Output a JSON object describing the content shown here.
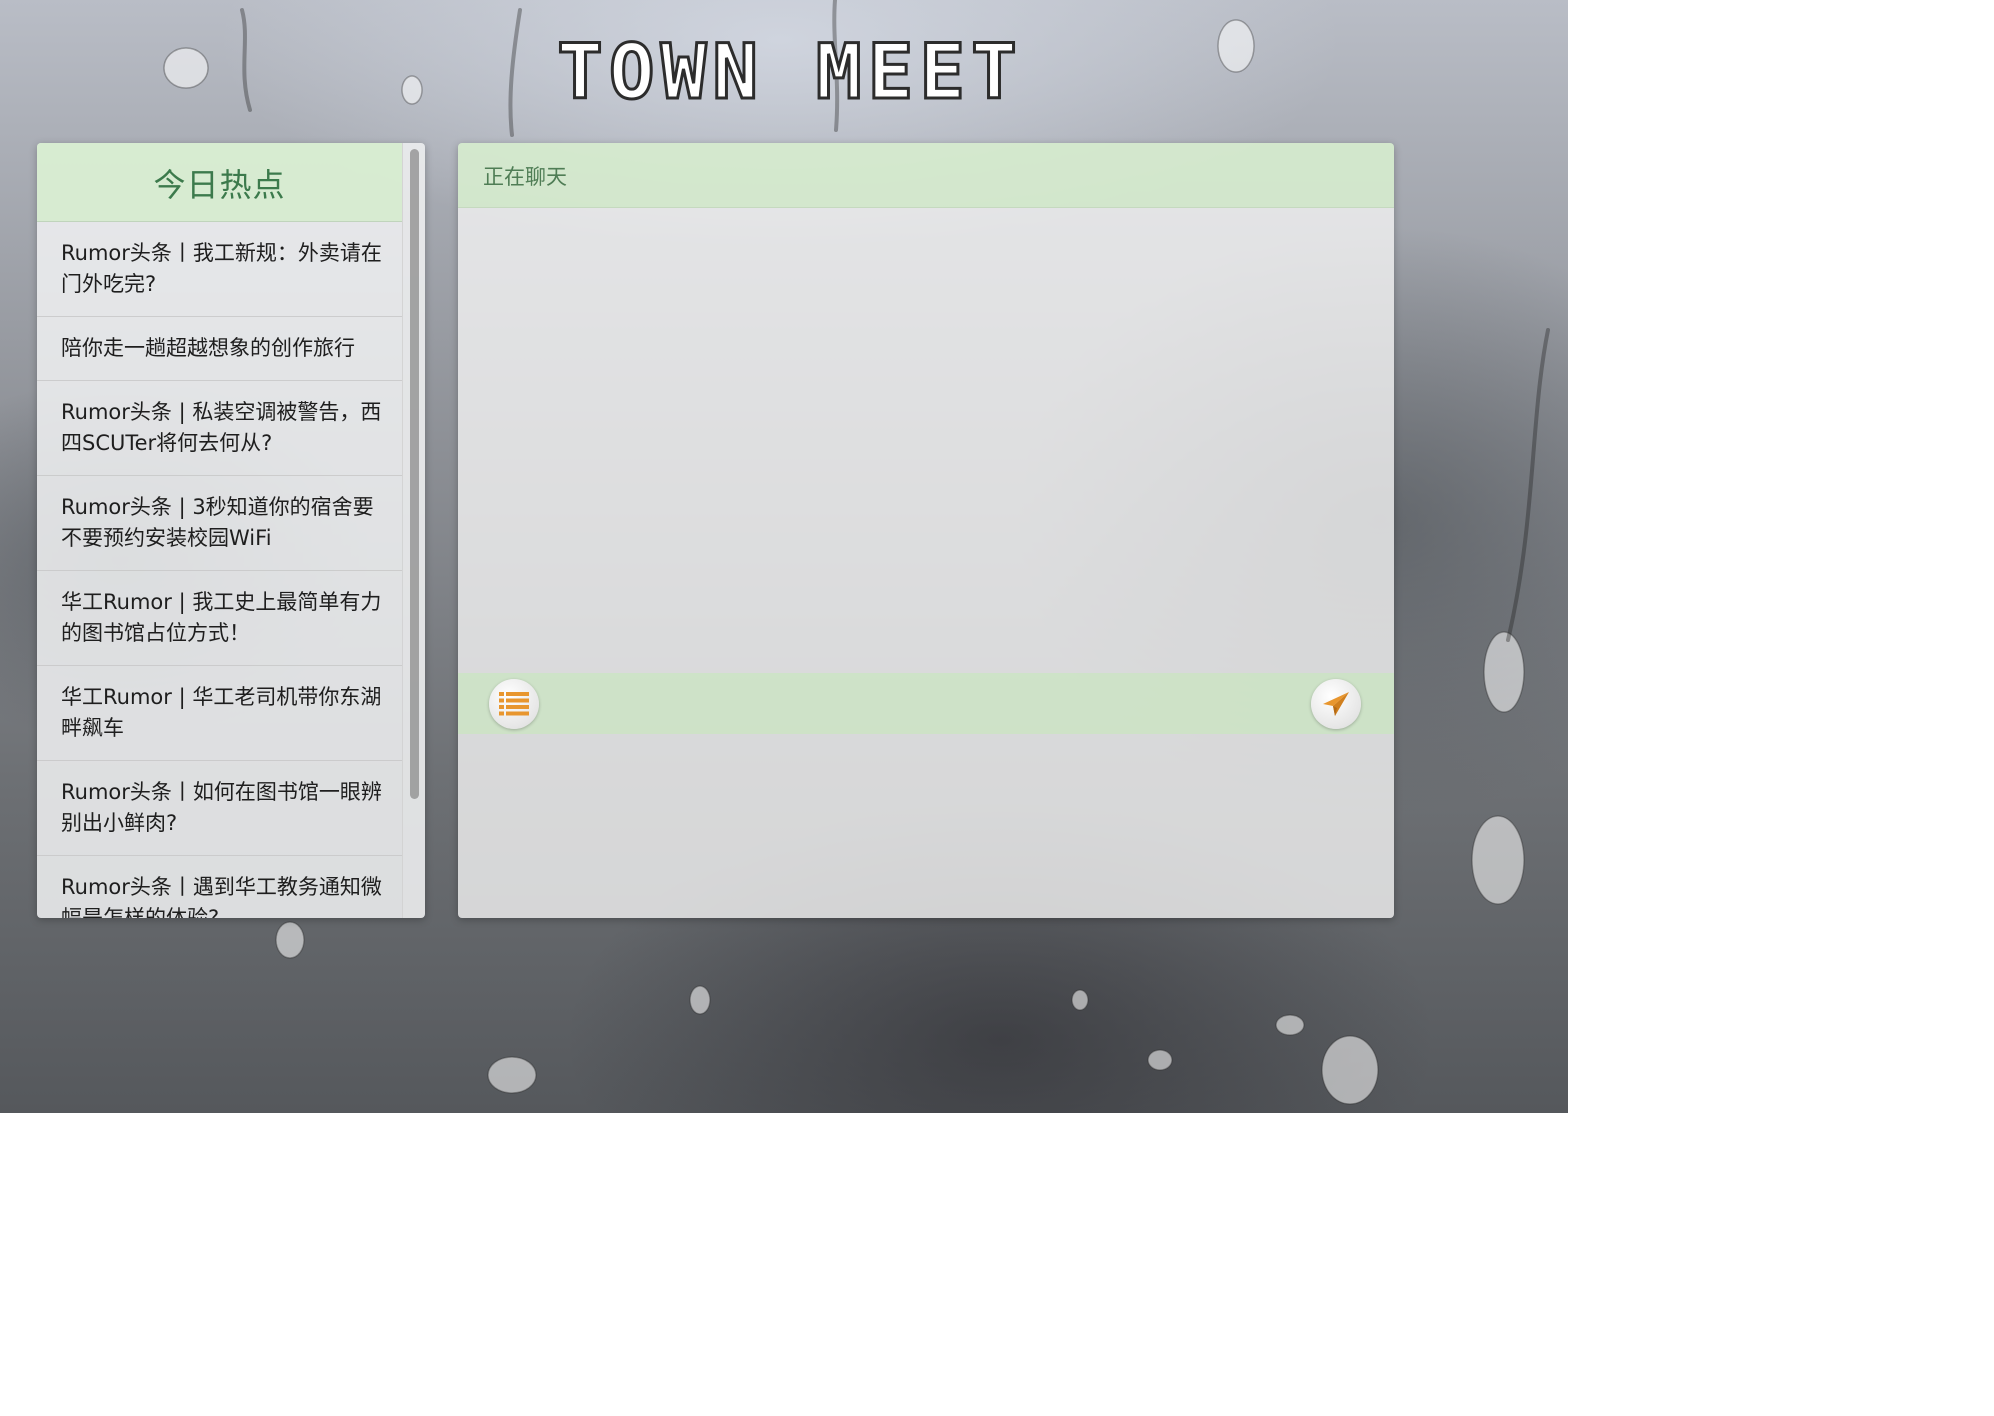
{
  "app": {
    "title": "TOWN MEET"
  },
  "sidebar": {
    "title": "今日热点",
    "items": [
      {
        "label": "Rumor头条丨我工新规：外卖请在门外吃完?"
      },
      {
        "label": "陪你走一趟超越想象的创作旅行"
      },
      {
        "label": "Rumor头条 | 私装空调被警告，西四SCUTer将何去何从?"
      },
      {
        "label": "Rumor头条 | 3秒知道你的宿舍要不要预约安装校园WiFi"
      },
      {
        "label": "华工Rumor | 我工史上最简单有力的图书馆占位方式！"
      },
      {
        "label": "华工Rumor | 华工老司机带你东湖畔飙车"
      },
      {
        "label": "Rumor头条丨如何在图书馆一眼辨别出小鲜肉?"
      },
      {
        "label": "Rumor头条丨遇到华工教务通知微幅是怎样的体验?"
      }
    ]
  },
  "chat": {
    "title": "正在聊天",
    "input_value": "",
    "list_button_icon": "list-icon",
    "send_button_icon": "paper-plane-icon"
  },
  "colors": {
    "header_green": "#d6ecce",
    "title_green": "#3c7a4c",
    "accent_orange": "#e8962e"
  }
}
